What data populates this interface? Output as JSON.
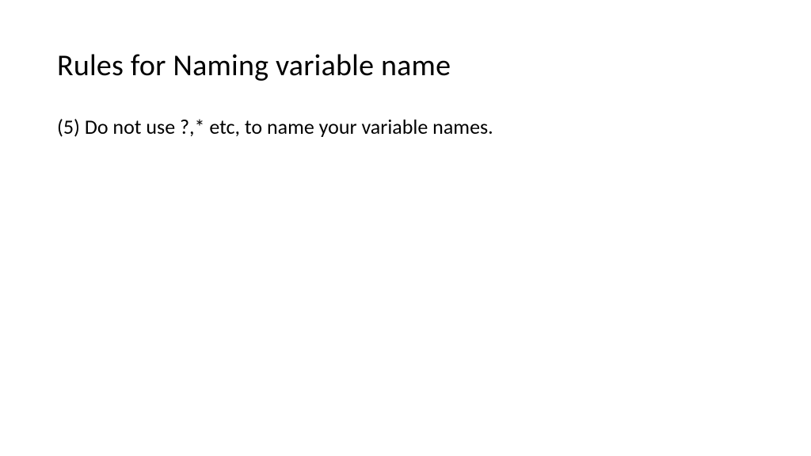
{
  "slide": {
    "title": "Rules for Naming variable name",
    "body": "(5) Do not use ?,* etc, to name your variable names."
  }
}
